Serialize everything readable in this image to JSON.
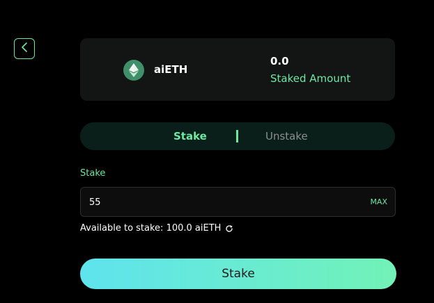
{
  "header": {
    "back_icon": "chevron-left-icon"
  },
  "token_card": {
    "token_icon": "ethereum-icon",
    "token_name": "aiETH",
    "staked_value": "0.0",
    "staked_label": "Staked Amount"
  },
  "tabs": {
    "stake_label": "Stake",
    "separator": "|",
    "unstake_label": "Unstake",
    "active": "Stake"
  },
  "stake_form": {
    "label": "Stake",
    "amount_value": "55",
    "max_label": "MAX",
    "available_text": "Available to stake: 100.0 aiETH",
    "refresh_icon": "refresh-icon",
    "submit_label": "Stake"
  },
  "colors": {
    "accent": "#6ee7a3",
    "card_bg": "#131515",
    "tab_bg": "#0b1f1a",
    "gradient_start": "#5fe3ee",
    "gradient_end": "#72f2b7"
  }
}
